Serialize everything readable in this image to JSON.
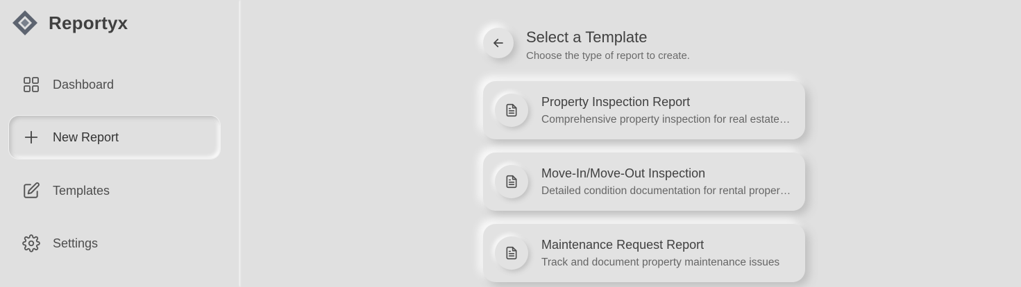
{
  "brand": {
    "name": "Reportyx",
    "icon": "diamond-logo-icon"
  },
  "sidebar": {
    "items": [
      {
        "label": "Dashboard",
        "icon": "grid-icon",
        "active": false
      },
      {
        "label": "New Report",
        "icon": "plus-icon",
        "active": true
      },
      {
        "label": "Templates",
        "icon": "edit-icon",
        "active": false
      },
      {
        "label": "Settings",
        "icon": "gear-icon",
        "active": false
      }
    ]
  },
  "header": {
    "title": "Select a Template",
    "subtitle": "Choose the type of report to create.",
    "back_icon": "arrow-left-icon"
  },
  "templates": [
    {
      "title": "Property Inspection Report",
      "description": "Comprehensive property inspection for real estate transactions",
      "icon": "document-icon"
    },
    {
      "title": "Move-In/Move-Out Inspection",
      "description": "Detailed condition documentation for rental properties",
      "icon": "document-icon"
    },
    {
      "title": "Maintenance Request Report",
      "description": "Track and document property maintenance issues",
      "icon": "document-icon"
    }
  ],
  "colors": {
    "background": "#e0e0e0",
    "text": "#404040",
    "muted": "#666666"
  }
}
